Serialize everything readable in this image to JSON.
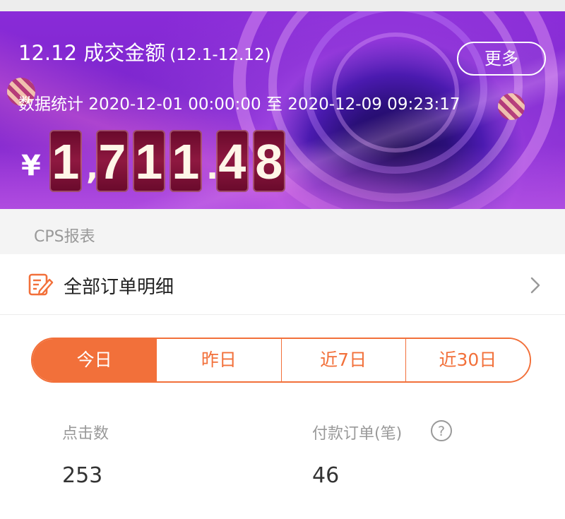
{
  "banner": {
    "title": "12.12 成交金额",
    "range": "(12.1-12.12)",
    "more_label": "更多",
    "stats_line": "数据统计 2020-12-01 00:00:00 至 2020-12-09 09:23:17",
    "currency": "¥",
    "digits": [
      "1",
      ",",
      "7",
      "1",
      "1",
      ".",
      "4",
      "8"
    ]
  },
  "cps": {
    "section_title": "CPS报表",
    "orders_row_label": "全部订单明细",
    "orders_icon": "edit-document-icon",
    "chevron_icon": "chevron-right-icon"
  },
  "tabs": [
    {
      "label": "今日",
      "active": true
    },
    {
      "label": "昨日",
      "active": false
    },
    {
      "label": "近7日",
      "active": false
    },
    {
      "label": "近30日",
      "active": false
    }
  ],
  "metrics": {
    "clicks": {
      "label": "点击数",
      "value": "253"
    },
    "paid_orders": {
      "label": "付款订单(笔)",
      "value": "46",
      "help_icon": "question-circle-icon"
    }
  },
  "colors": {
    "accent": "#f2703a",
    "banner_purple": "#8a2bd8",
    "digit_tile": "#8e1840"
  }
}
